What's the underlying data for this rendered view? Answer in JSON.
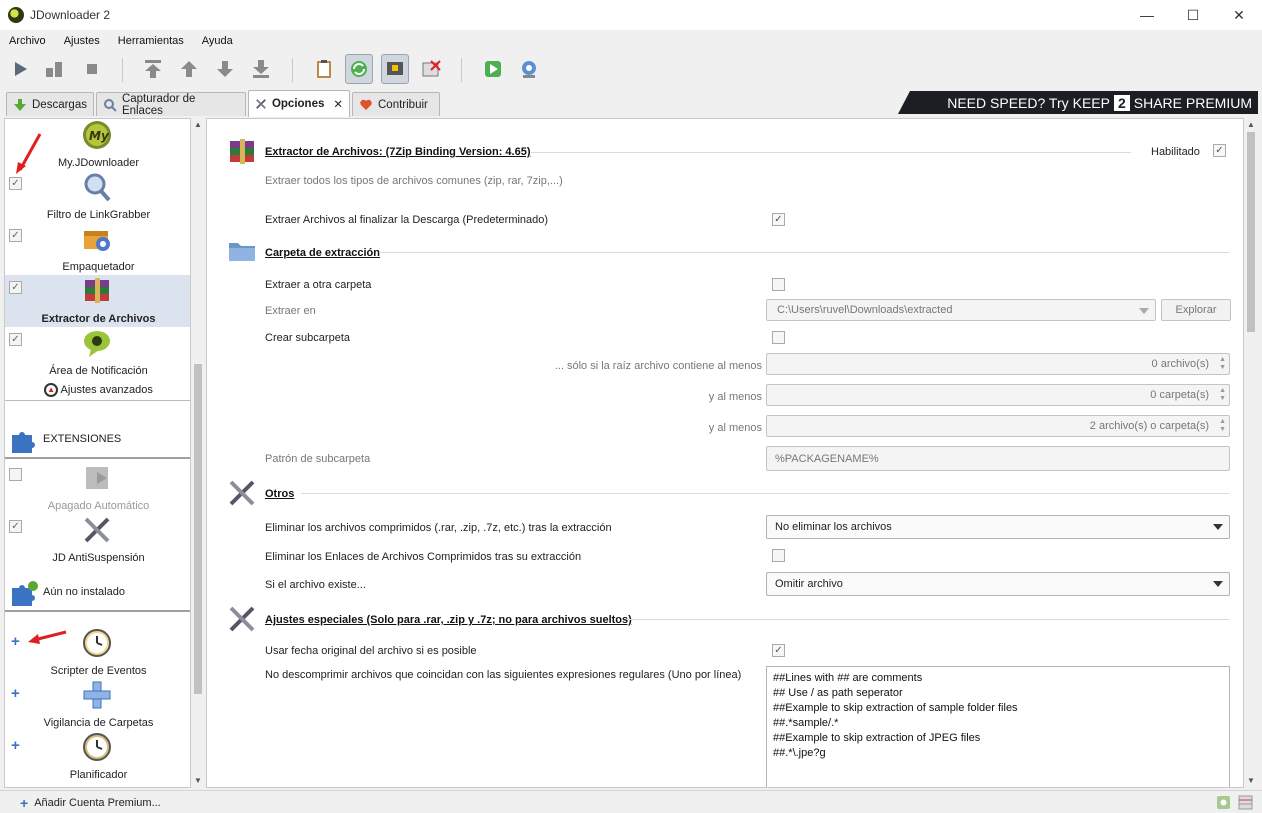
{
  "window": {
    "title": "JDownloader 2",
    "minimize": "—",
    "maximize": "☐",
    "close": "✕"
  },
  "menu": [
    "Archivo",
    "Ajustes",
    "Herramientas",
    "Ayuda"
  ],
  "tabs": {
    "downloads": "Descargas",
    "linkgrabber": "Capturador de Enlaces",
    "options": "Opciones",
    "contribute": "Contribuir",
    "close_glyph": "✕"
  },
  "banner": {
    "need_speed": "NEED SPEED? Try",
    "keep": "KEEP",
    "two": "2",
    "share": "SHARE PREMIUM"
  },
  "sidebar": {
    "myjd": "My.JDownloader",
    "filter": "Filtro de LinkGrabber",
    "packager": "Empaquetador",
    "extractor": "Extractor de Archivos",
    "notification": "Área de Notificación",
    "advanced": "Ajustes avanzados",
    "extensions_header": "EXTENSIONES",
    "shutdown": "Apagado Automático",
    "antisuspend": "JD AntiSuspensión",
    "not_installed_header": "Aún no instalado",
    "scripter": "Scripter de Eventos",
    "folderwatch": "Vigilancia de Carpetas",
    "scheduler": "Planificador",
    "check_glyph": "✓",
    "plus_glyph": "+"
  },
  "main": {
    "extractor": {
      "title": "Extractor de Archivos: (7Zip Binding Version: 4.65)",
      "enabled_label": "Habilitado",
      "description": "Extraer todos los tipos de archivos comunes (zip, rar, 7zip,...)",
      "extract_after_download": "Extraer Archivos al finalizar la Descarga (Predeterminado)"
    },
    "folder": {
      "title": "Carpeta de extracción",
      "extract_other": "Extraer a otra carpeta",
      "extract_in": "Extraer en",
      "extract_path": "C:\\Users\\ruvel\\Downloads\\extracted",
      "browse": "Explorar",
      "create_subfolder": "Crear subcarpeta",
      "only_if_root": "... sólo si la raíz archivo contiene al menos",
      "only_if_root_value": "0 archivo(s)",
      "and_at_least_1": "y al menos",
      "and_at_least_1_value": "0 carpeta(s)",
      "and_at_least_2": "y al menos",
      "and_at_least_2_value": "2 archivo(s) o carpeta(s)",
      "pattern_label": "Patrón de subcarpeta",
      "pattern_value": "%PACKAGENAME%"
    },
    "others": {
      "title": "Otros",
      "delete_archives": "Eliminar los archivos comprimidos (.rar, .zip, .7z, etc.) tras la extracción",
      "delete_archives_value": "No eliminar los archivos",
      "delete_links": "Eliminar los Enlaces de Archivos Comprimidos tras su extracción",
      "if_exists": "Si el archivo existe...",
      "if_exists_value": "Omitir archivo"
    },
    "special": {
      "title": "Ajustes especiales (Solo para .rar, .zip y .7z; no para archivos sueltos)",
      "use_original_date": "Usar fecha original del archivo si es posible",
      "no_extract_regex": "No descomprimir archivos que coincidan con las siguientes expresiones regulares (Uno por línea)",
      "regex_lines": [
        "##Lines with ## are comments",
        "## Use / as path seperator",
        "##Example to skip extraction of sample folder files",
        "##.*sample/.*",
        "##Example to skip extraction of JPEG files",
        "##.*\\.jpe?g"
      ]
    },
    "check_glyph": "✓"
  },
  "statusbar": {
    "add_premium": "Añadir Cuenta Premium...",
    "plus_glyph": "+"
  }
}
